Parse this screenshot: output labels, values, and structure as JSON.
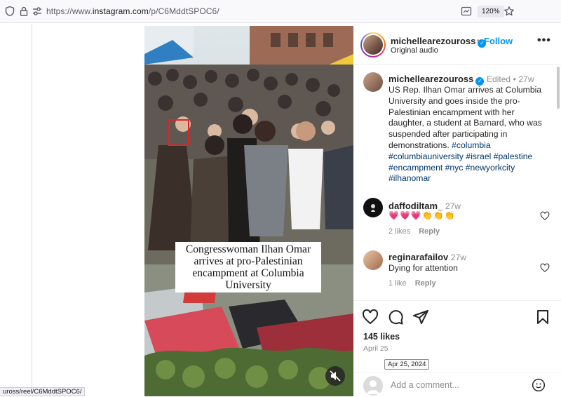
{
  "browser": {
    "url_prefix": "https://www.",
    "url_domain": "instagram.com",
    "url_path": "/p/C6MddtSPOC6/",
    "zoom": "120%",
    "status_link": "uross/reel/C6MddtSPOC6/"
  },
  "video": {
    "caption": "Congresswoman Ilhan Omar arrives at pro-Palestinian encampment at Columbia University"
  },
  "post": {
    "author": "michellearezouross",
    "follow_label": "Follow",
    "audio": "Original audio",
    "dot": "•",
    "more": "•••",
    "caption_author": "michellearezouross",
    "edited": "Edited",
    "age": "27w",
    "caption_text": "US Rep. Ilhan Omar arrives at Columbia University and goes inside the pro-Palestinian encampment with her daughter, a student at Barnard, who was suspended after participating in demonstrations.",
    "hashtags": [
      "#columbia",
      "#columbiauniversity",
      "#israel",
      "#palestine",
      "#encampment",
      "#nyc",
      "#newyorkcity",
      "#ilhanomar"
    ],
    "likes": "145 likes",
    "date": "April 25",
    "date_tooltip": "Apr 25, 2024",
    "add_comment_placeholder": "Add a comment..."
  },
  "comments": [
    {
      "user": "daffodiltam_",
      "age": "27w",
      "text": "💗💗💗👏👏👏",
      "likes": "2 likes",
      "reply": "Reply"
    },
    {
      "user": "reginarafailov",
      "age": "27w",
      "text": "Dying for attention",
      "likes": "1 like",
      "reply": "Reply"
    }
  ],
  "colors": {
    "link_blue": "#0095f6",
    "hashtag": "#00376b",
    "muted": "#8e8e8e"
  },
  "icons": [
    "shield-icon",
    "lock-icon",
    "permissions-icon",
    "reader-view-icon",
    "bookmark-star-icon",
    "more-icon",
    "heart-icon",
    "comment-icon",
    "share-icon",
    "save-icon",
    "emoji-icon",
    "mute-icon"
  ]
}
